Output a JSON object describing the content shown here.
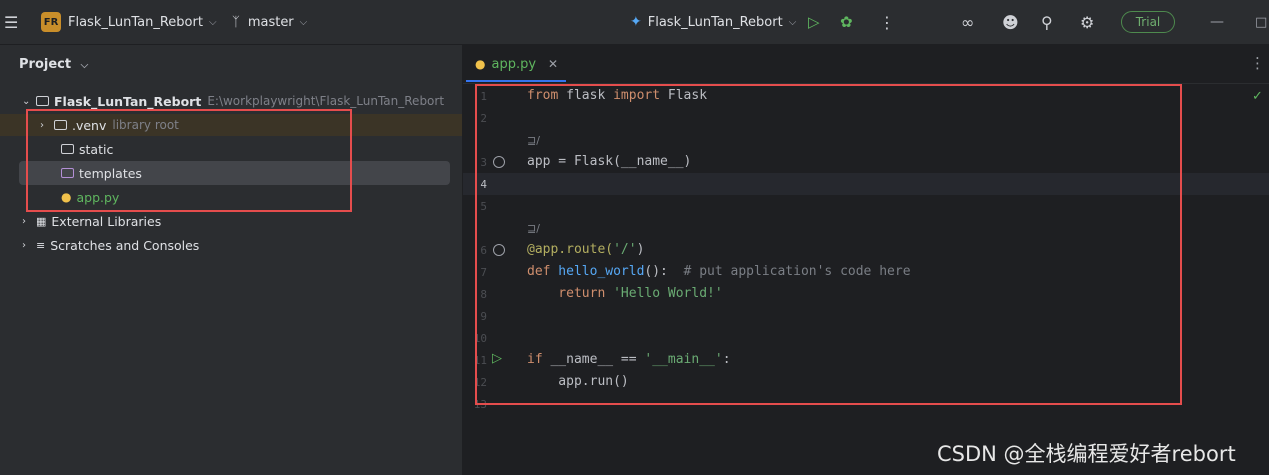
{
  "titlebar": {
    "project_badge": "FR",
    "project_name": "Flask_LunTan_Rebort",
    "branch": "master",
    "run_config": "Flask_LunTan_Rebort",
    "trial_label": "Trial"
  },
  "sidebar": {
    "header": "Project",
    "root_name": "Flask_LunTan_Rebort",
    "root_path": "E:\\workplaywright\\Flask_LunTan_Rebort",
    "items": [
      {
        "label": ".venv",
        "note": "library root"
      },
      {
        "label": "static"
      },
      {
        "label": "templates"
      },
      {
        "label": "app.py"
      }
    ],
    "external_libraries": "External Libraries",
    "scratches": "Scratches and Consoles"
  },
  "editor": {
    "tab_label": "app.py",
    "line_numbers": [
      "1",
      "2",
      "3",
      "4",
      "5",
      "6",
      "7",
      "8",
      "9",
      "10",
      "11",
      "12",
      "13"
    ],
    "code": {
      "l1_kw1": "from",
      "l1_mod": " flask ",
      "l1_kw2": "import",
      "l1_name": " Flask",
      "hint_usage": "⊒/",
      "l3": "app = Flask(__name__)",
      "l6_dec": "@app.route(",
      "l6_str": "'/'",
      "l6_end": ")",
      "l7_kw": "def",
      "l7_fn": " hello_world",
      "l7_rest": "():  ",
      "l7_cmt": "# put application's code here",
      "l8_kw": "    return",
      "l8_str": " 'Hello World!'",
      "l11_kw": "if",
      "l11_mid": " __name__ == ",
      "l11_str": "'__main__'",
      "l11_end": ":",
      "l12": "    app.run()"
    }
  },
  "watermark": "CSDN @全栈编程爱好者rebort",
  "colors": {
    "accent_green": "#5fb65f",
    "highlight_red": "#e54d4d",
    "badge_orange": "#c98e2a"
  }
}
